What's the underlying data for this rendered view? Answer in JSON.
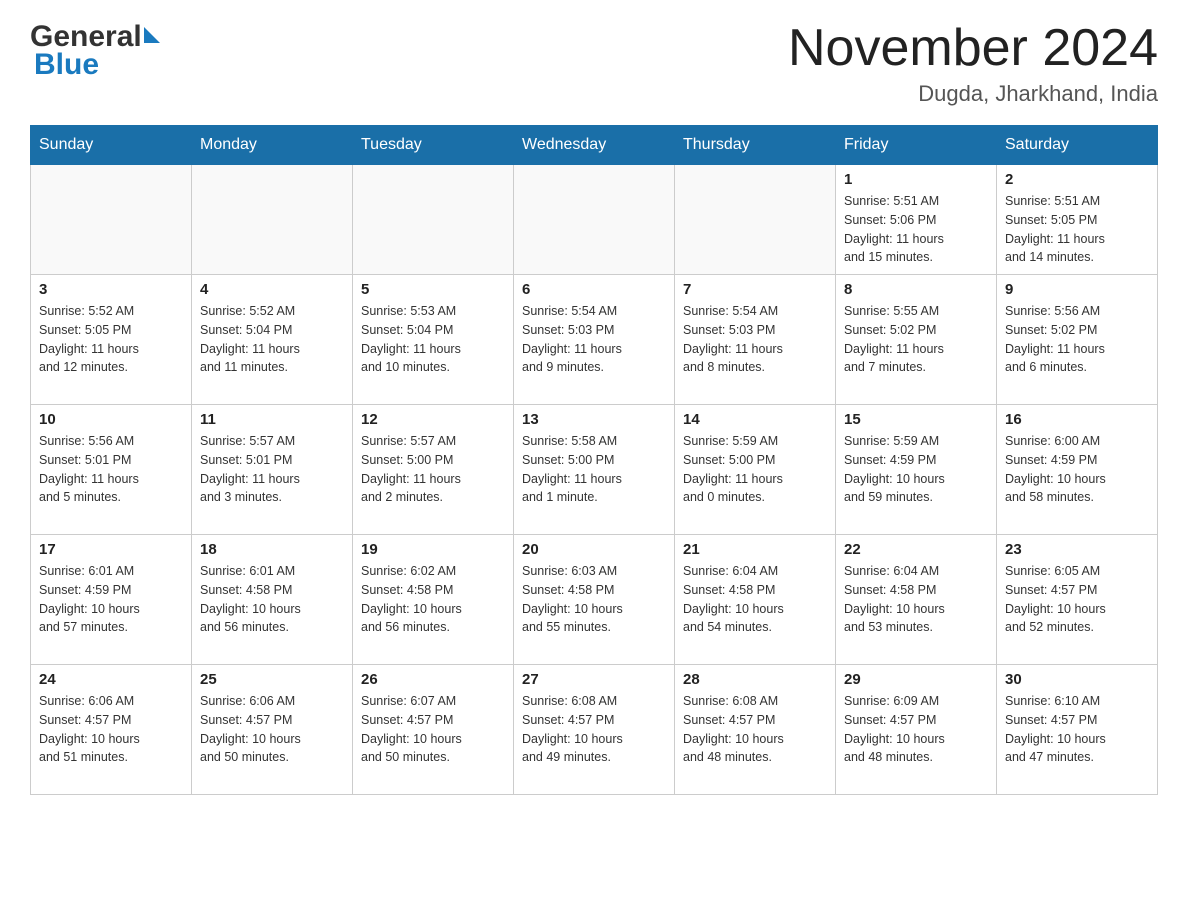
{
  "header": {
    "logo_general": "General",
    "logo_blue": "Blue",
    "title": "November 2024",
    "subtitle": "Dugda, Jharkhand, India"
  },
  "days_of_week": [
    "Sunday",
    "Monday",
    "Tuesday",
    "Wednesday",
    "Thursday",
    "Friday",
    "Saturday"
  ],
  "weeks": [
    {
      "days": [
        {
          "num": "",
          "info": "",
          "empty": true
        },
        {
          "num": "",
          "info": "",
          "empty": true
        },
        {
          "num": "",
          "info": "",
          "empty": true
        },
        {
          "num": "",
          "info": "",
          "empty": true
        },
        {
          "num": "",
          "info": "",
          "empty": true
        },
        {
          "num": "1",
          "info": "Sunrise: 5:51 AM\nSunset: 5:06 PM\nDaylight: 11 hours\nand 15 minutes.",
          "empty": false
        },
        {
          "num": "2",
          "info": "Sunrise: 5:51 AM\nSunset: 5:05 PM\nDaylight: 11 hours\nand 14 minutes.",
          "empty": false
        }
      ]
    },
    {
      "days": [
        {
          "num": "3",
          "info": "Sunrise: 5:52 AM\nSunset: 5:05 PM\nDaylight: 11 hours\nand 12 minutes.",
          "empty": false
        },
        {
          "num": "4",
          "info": "Sunrise: 5:52 AM\nSunset: 5:04 PM\nDaylight: 11 hours\nand 11 minutes.",
          "empty": false
        },
        {
          "num": "5",
          "info": "Sunrise: 5:53 AM\nSunset: 5:04 PM\nDaylight: 11 hours\nand 10 minutes.",
          "empty": false
        },
        {
          "num": "6",
          "info": "Sunrise: 5:54 AM\nSunset: 5:03 PM\nDaylight: 11 hours\nand 9 minutes.",
          "empty": false
        },
        {
          "num": "7",
          "info": "Sunrise: 5:54 AM\nSunset: 5:03 PM\nDaylight: 11 hours\nand 8 minutes.",
          "empty": false
        },
        {
          "num": "8",
          "info": "Sunrise: 5:55 AM\nSunset: 5:02 PM\nDaylight: 11 hours\nand 7 minutes.",
          "empty": false
        },
        {
          "num": "9",
          "info": "Sunrise: 5:56 AM\nSunset: 5:02 PM\nDaylight: 11 hours\nand 6 minutes.",
          "empty": false
        }
      ]
    },
    {
      "days": [
        {
          "num": "10",
          "info": "Sunrise: 5:56 AM\nSunset: 5:01 PM\nDaylight: 11 hours\nand 5 minutes.",
          "empty": false
        },
        {
          "num": "11",
          "info": "Sunrise: 5:57 AM\nSunset: 5:01 PM\nDaylight: 11 hours\nand 3 minutes.",
          "empty": false
        },
        {
          "num": "12",
          "info": "Sunrise: 5:57 AM\nSunset: 5:00 PM\nDaylight: 11 hours\nand 2 minutes.",
          "empty": false
        },
        {
          "num": "13",
          "info": "Sunrise: 5:58 AM\nSunset: 5:00 PM\nDaylight: 11 hours\nand 1 minute.",
          "empty": false
        },
        {
          "num": "14",
          "info": "Sunrise: 5:59 AM\nSunset: 5:00 PM\nDaylight: 11 hours\nand 0 minutes.",
          "empty": false
        },
        {
          "num": "15",
          "info": "Sunrise: 5:59 AM\nSunset: 4:59 PM\nDaylight: 10 hours\nand 59 minutes.",
          "empty": false
        },
        {
          "num": "16",
          "info": "Sunrise: 6:00 AM\nSunset: 4:59 PM\nDaylight: 10 hours\nand 58 minutes.",
          "empty": false
        }
      ]
    },
    {
      "days": [
        {
          "num": "17",
          "info": "Sunrise: 6:01 AM\nSunset: 4:59 PM\nDaylight: 10 hours\nand 57 minutes.",
          "empty": false
        },
        {
          "num": "18",
          "info": "Sunrise: 6:01 AM\nSunset: 4:58 PM\nDaylight: 10 hours\nand 56 minutes.",
          "empty": false
        },
        {
          "num": "19",
          "info": "Sunrise: 6:02 AM\nSunset: 4:58 PM\nDaylight: 10 hours\nand 56 minutes.",
          "empty": false
        },
        {
          "num": "20",
          "info": "Sunrise: 6:03 AM\nSunset: 4:58 PM\nDaylight: 10 hours\nand 55 minutes.",
          "empty": false
        },
        {
          "num": "21",
          "info": "Sunrise: 6:04 AM\nSunset: 4:58 PM\nDaylight: 10 hours\nand 54 minutes.",
          "empty": false
        },
        {
          "num": "22",
          "info": "Sunrise: 6:04 AM\nSunset: 4:58 PM\nDaylight: 10 hours\nand 53 minutes.",
          "empty": false
        },
        {
          "num": "23",
          "info": "Sunrise: 6:05 AM\nSunset: 4:57 PM\nDaylight: 10 hours\nand 52 minutes.",
          "empty": false
        }
      ]
    },
    {
      "days": [
        {
          "num": "24",
          "info": "Sunrise: 6:06 AM\nSunset: 4:57 PM\nDaylight: 10 hours\nand 51 minutes.",
          "empty": false
        },
        {
          "num": "25",
          "info": "Sunrise: 6:06 AM\nSunset: 4:57 PM\nDaylight: 10 hours\nand 50 minutes.",
          "empty": false
        },
        {
          "num": "26",
          "info": "Sunrise: 6:07 AM\nSunset: 4:57 PM\nDaylight: 10 hours\nand 50 minutes.",
          "empty": false
        },
        {
          "num": "27",
          "info": "Sunrise: 6:08 AM\nSunset: 4:57 PM\nDaylight: 10 hours\nand 49 minutes.",
          "empty": false
        },
        {
          "num": "28",
          "info": "Sunrise: 6:08 AM\nSunset: 4:57 PM\nDaylight: 10 hours\nand 48 minutes.",
          "empty": false
        },
        {
          "num": "29",
          "info": "Sunrise: 6:09 AM\nSunset: 4:57 PM\nDaylight: 10 hours\nand 48 minutes.",
          "empty": false
        },
        {
          "num": "30",
          "info": "Sunrise: 6:10 AM\nSunset: 4:57 PM\nDaylight: 10 hours\nand 47 minutes.",
          "empty": false
        }
      ]
    }
  ]
}
